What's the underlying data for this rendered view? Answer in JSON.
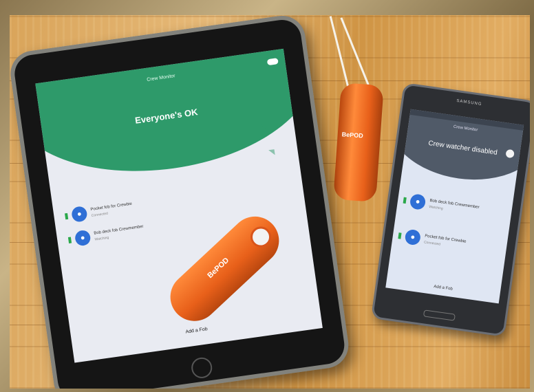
{
  "tablet": {
    "app_title": "Crew Monitor",
    "status_heading": "Everyone's OK",
    "crew": [
      {
        "name": "Pocket fob for Crewbie",
        "sub": "Connected"
      },
      {
        "name": "Bob deck fob Crewmember",
        "sub": "Watching"
      }
    ],
    "add_label": "Add a Fob",
    "fob_logo": "BePOD"
  },
  "phone": {
    "brand": "SAMSUNG",
    "app_title": "Crew Monitor",
    "status_heading": "Crew watcher disabled",
    "crew": [
      {
        "name": "Bob deck fob Crewmember",
        "sub": "Watching"
      },
      {
        "name": "Pocket fob for Crewbie",
        "sub": "Connected"
      }
    ],
    "add_label": "Add a Fob"
  },
  "hanging_fob": {
    "logo": "BePOD"
  },
  "colors": {
    "tablet_header": "#2e9a6a",
    "phone_header": "#505a68",
    "fob": "#e8601a",
    "mic_badge": "#2f6fd6"
  }
}
